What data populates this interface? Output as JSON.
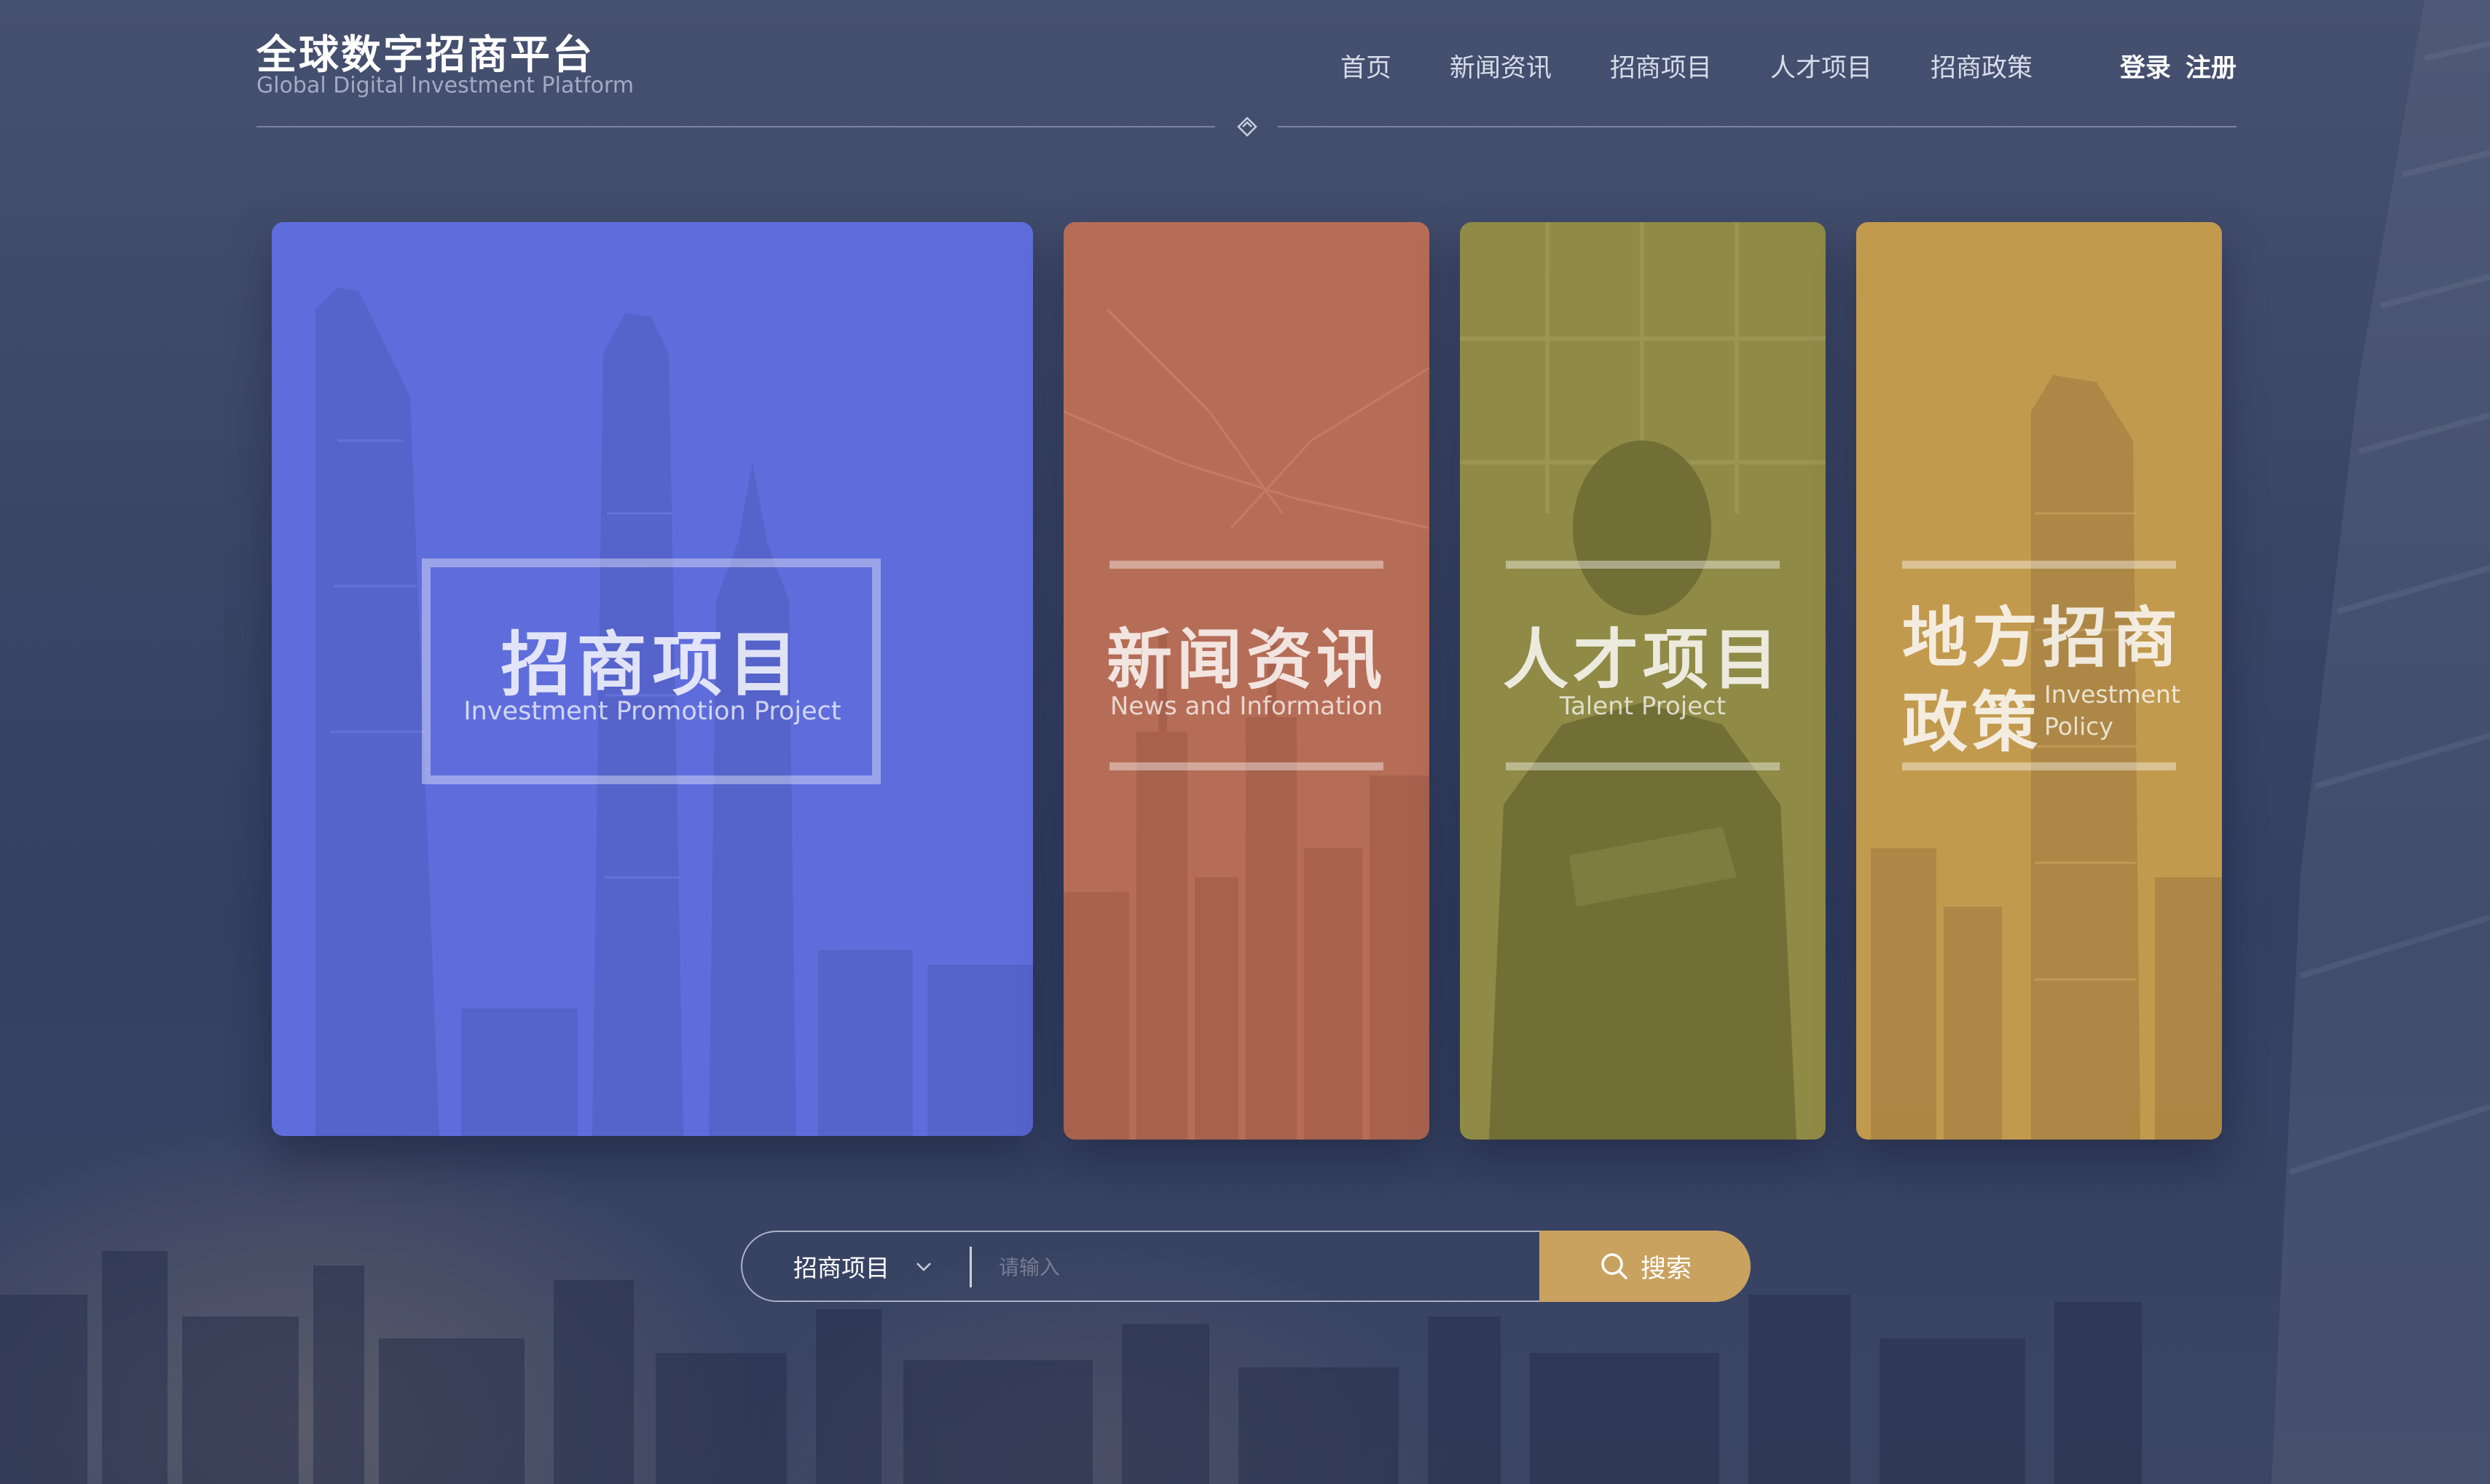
{
  "header": {
    "brand_title": "全球数字招商平台",
    "brand_subtitle": "Global Digital Investment Platform",
    "nav": [
      "首页",
      "新闻资讯",
      "招商项目",
      "人才项目",
      "招商政策"
    ],
    "login": "登录",
    "register": "注册"
  },
  "cards": [
    {
      "title": "招商项目",
      "subtitle": "Investment Promotion Project",
      "color": "#5f6ddc"
    },
    {
      "title": "新闻资讯",
      "subtitle": "News and Information",
      "color": "#b66d57"
    },
    {
      "title": "人才项目",
      "subtitle": "Talent Project",
      "color": "#8f8a45"
    },
    {
      "title_line1": "地方招商",
      "title_line2": "政策",
      "subtitle_line1": "Investment",
      "subtitle_line2": "Policy",
      "color": "#c29a4e"
    }
  ],
  "search": {
    "category": "招商项目",
    "placeholder": "请输入",
    "button_label": "搜索",
    "button_color": "#c9a260"
  },
  "icons": {
    "divider": "diamond-icon",
    "dropdown": "chevron-down-icon",
    "search": "search-icon"
  }
}
